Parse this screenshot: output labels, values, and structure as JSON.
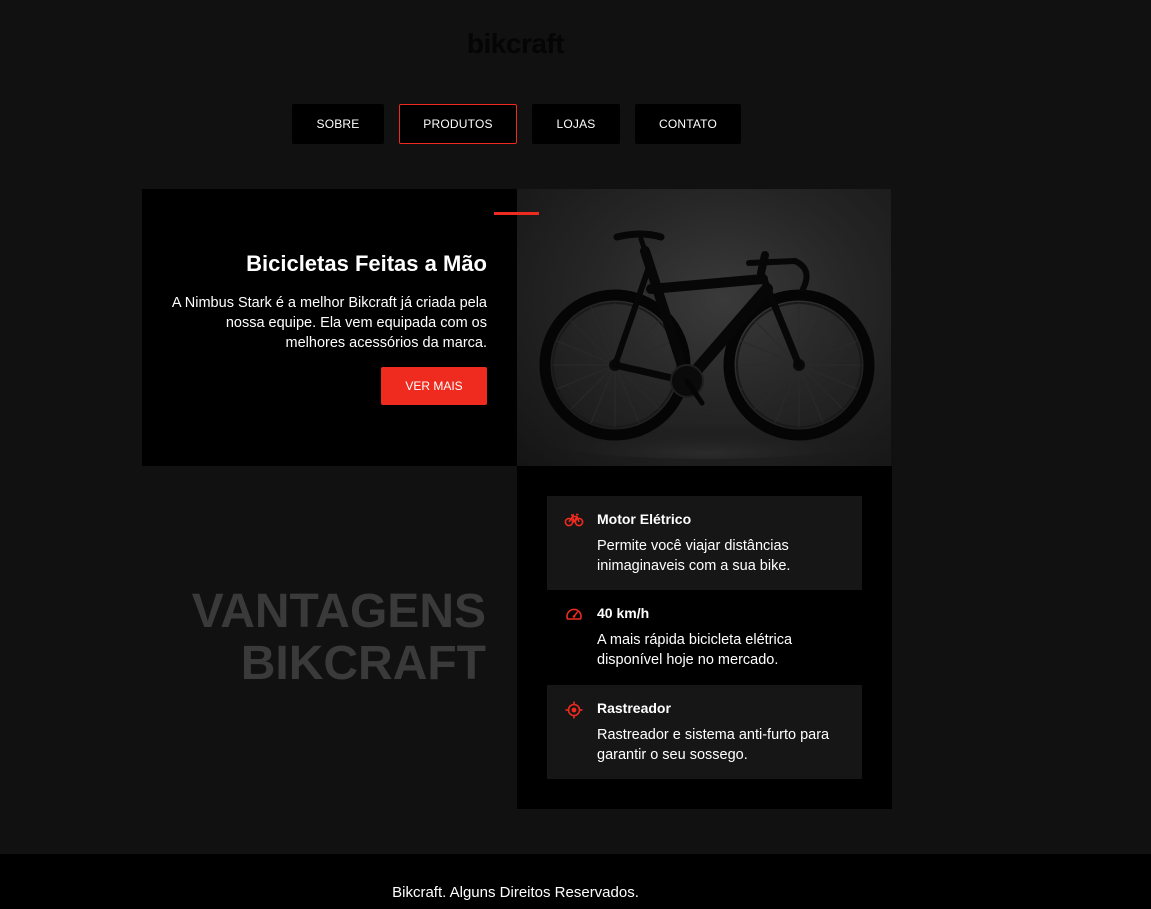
{
  "header": {
    "logo": "bikcraft"
  },
  "nav": {
    "items": [
      {
        "label": "SOBRE",
        "active": false
      },
      {
        "label": "PRODUTOS",
        "active": true
      },
      {
        "label": "LOJAS",
        "active": false
      },
      {
        "label": "CONTATO",
        "active": false
      }
    ]
  },
  "hero": {
    "title": "Bicicletas Feitas a Mão",
    "description": "A Nimbus Stark é a melhor Bikcraft já criada pela nossa equipe. Ela vem equipada com os melhores acessórios da marca.",
    "button": "VER MAIS",
    "image_icon": "road-bike-photo"
  },
  "vantagens": {
    "title": "VANTAGENS\nBIKCRAFT",
    "items": [
      {
        "icon": "bicycle-icon",
        "name": "Motor Elétrico",
        "description": "Permite você viajar distâncias inimaginaveis com a sua bike."
      },
      {
        "icon": "speedometer-icon",
        "name": "40 km/h",
        "description": "A mais rápida bicicleta elétrica disponível hoje no mercado."
      },
      {
        "icon": "target-icon",
        "name": "Rastreador",
        "description": "Rastreador e sistema anti-furto para garantir o seu sossego."
      }
    ]
  },
  "footer": {
    "text": "Bikcraft. Alguns Direitos Reservados."
  },
  "colors": {
    "accent": "#ee2b1e",
    "background": "#111111",
    "panel": "#000000"
  }
}
